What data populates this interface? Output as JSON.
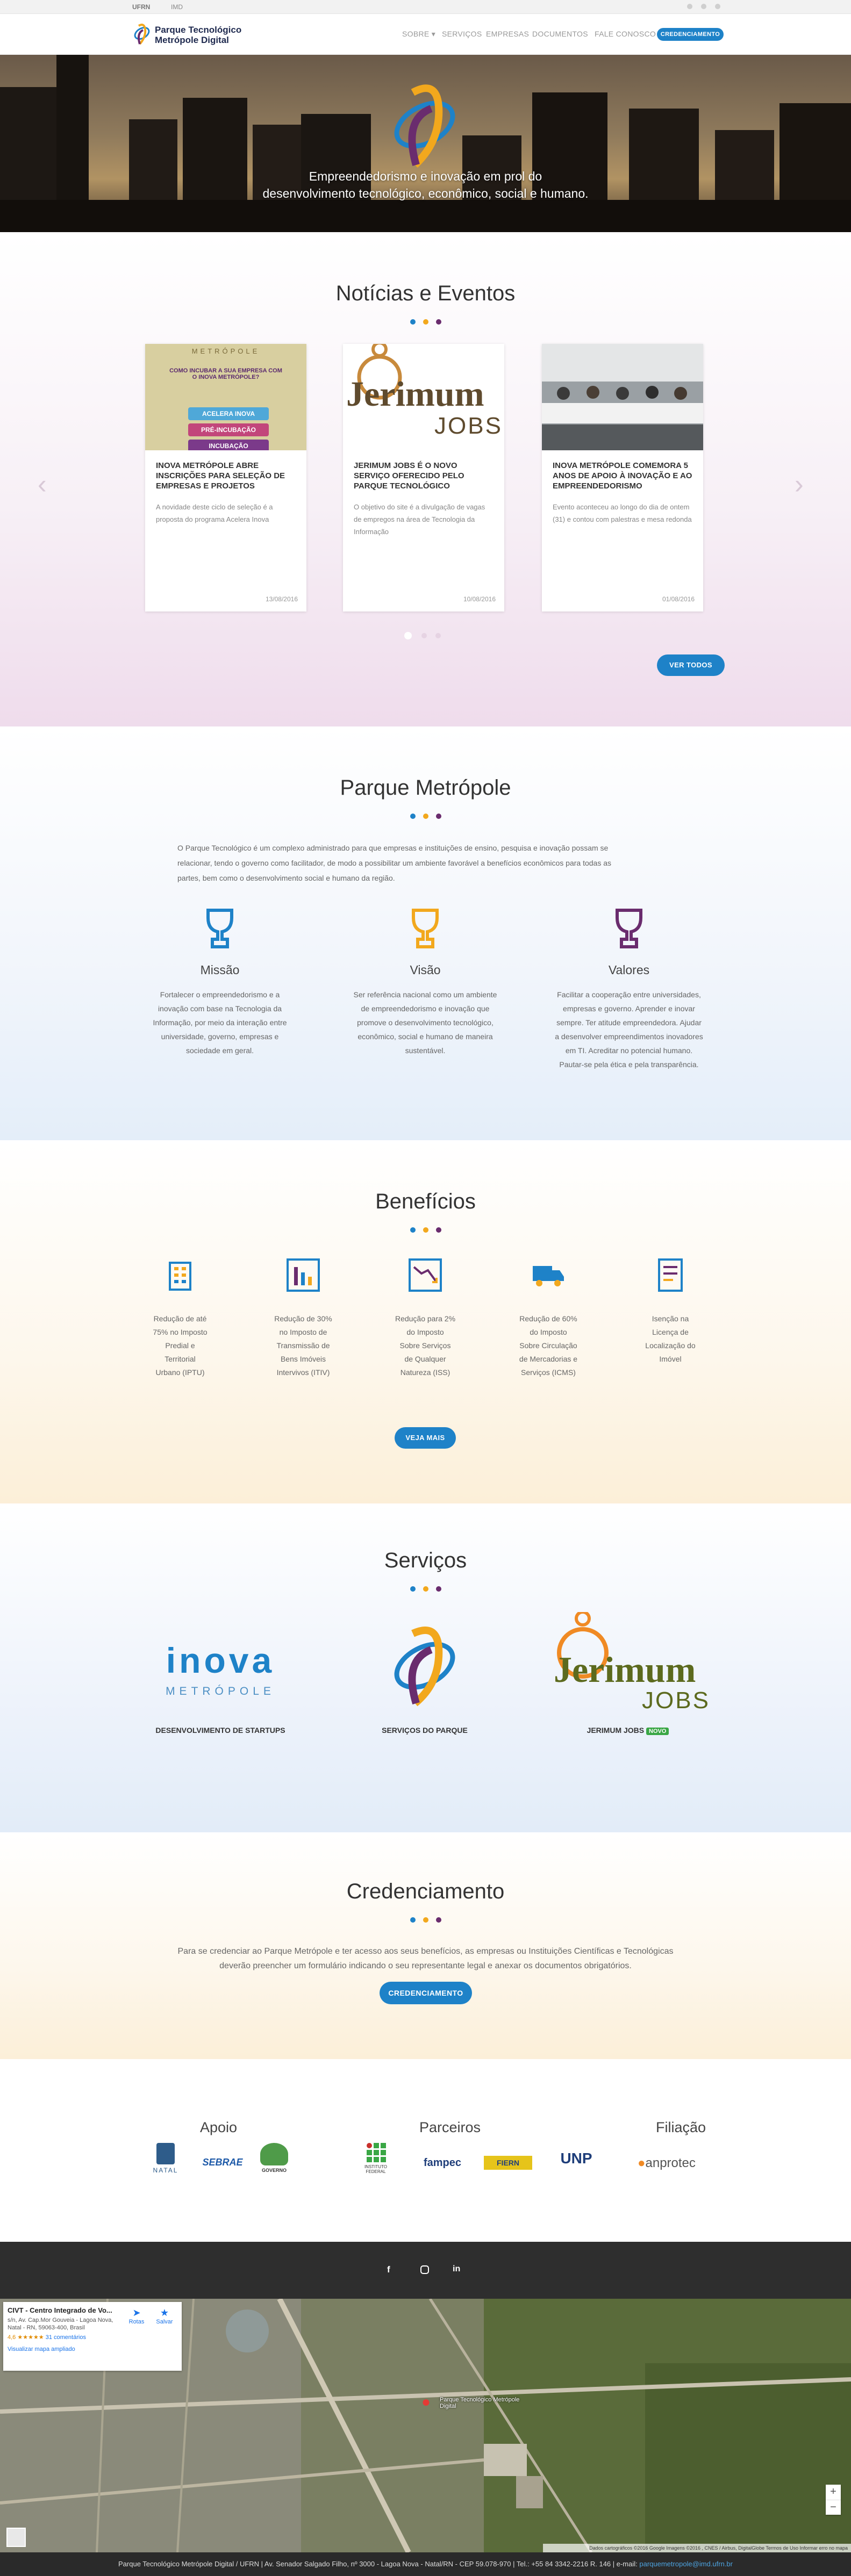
{
  "topbar": {
    "links": [
      "UFRN",
      "IMD"
    ],
    "social": [
      "facebook-icon",
      "instagram-icon",
      "linkedin-icon"
    ]
  },
  "header": {
    "logo_line1": "Parque Tecnológico",
    "logo_line2": "Metrópole Digital",
    "menu": [
      "SOBRE ▾",
      "SERVIÇOS",
      "EMPRESAS",
      "DOCUMENTOS",
      "FALE CONOSCO"
    ],
    "cta": "CREDENCIAMENTO"
  },
  "hero": {
    "title_line1": "Empreendedorismo e inovação em prol do",
    "title_line2": "desenvolvimento tecnológico, econômico, social e humano."
  },
  "news": {
    "title": "Notícias e Eventos",
    "cards": [
      {
        "title": "INOVA METRÓPOLE ABRE INSCRIÇÕES PARA SELEÇÃO DE EMPRESAS E PROJETOS",
        "text": "A novidade deste ciclo de seleção é a proposta do programa Acelera Inova",
        "date": "13/08/2016",
        "img_brand": "METRÓPOLE",
        "img_headline": "COMO INCUBAR A SUA EMPRESA COM O INOVA METRÓPOLE?",
        "img_tags": [
          "ACELERA INOVA",
          "PRÉ-INCUBAÇÃO",
          "INCUBAÇÃO"
        ]
      },
      {
        "title": "JERIMUM JOBS É O NOVO SERVIÇO OFERECIDO PELO PARQUE TECNOLÓGICO",
        "text": "O objetivo do site é a divulgação de vagas de empregos na área de Tecnologia da Informação",
        "date": "10/08/2016",
        "img_brand": "Jerimum",
        "img_sub": "JOBS"
      },
      {
        "title": "INOVA METRÓPOLE COMEMORA 5 ANOS DE APOIO À INOVAÇÃO E AO EMPREENDEDORISMO",
        "text": "Evento aconteceu ao longo do dia de ontem (31) e contou com palestras e mesa redonda",
        "date": "01/08/2016"
      }
    ],
    "view_all": "VER TODOS"
  },
  "about": {
    "title": "Parque Metrópole",
    "intro_lines": [
      "O Parque Tecnológico é um complexo administrado para que empresas e instituições de ensino, pesquisa e inovação possam se",
      "relacionar, tendo o governo como facilitador, de modo a possibilitar um ambiente favorável a benefícios econômicos para todas as",
      "partes, bem como o desenvolvimento social e humano da região."
    ],
    "columns": [
      {
        "title": "Missão",
        "color": "#1e82c8",
        "lines": [
          "Fortalecer o empreendedorismo e a",
          "inovação com base na Tecnologia da",
          "Informação, por meio da interação entre",
          "universidade, governo, empresas e",
          "sociedade em geral."
        ]
      },
      {
        "title": "Visão",
        "color": "#f2a81d",
        "lines": [
          "Ser referência nacional como um ambiente",
          "de empreendedorismo e inovação que",
          "promove o desenvolvimento tecnológico,",
          "econômico, social e humano de maneira",
          "sustentável."
        ]
      },
      {
        "title": "Valores",
        "color": "#6a2c6e",
        "lines": [
          "Facilitar a cooperação entre universidades,",
          "empresas e governo. Aprender e inovar",
          "sempre. Ter atitude empreendedora. Ajudar",
          "a desenvolver empreendimentos inovadores",
          "em TI. Acreditar no potencial humano.",
          "Pautar-se pela ética e pela transparência."
        ]
      }
    ]
  },
  "benefits": {
    "title": "Benefícios",
    "items": [
      {
        "icon": "building-icon",
        "lines": [
          "Redução de até",
          "75% no Imposto",
          "Predial e",
          "Territorial",
          "Urbano (IPTU)"
        ]
      },
      {
        "icon": "bar-chart-icon",
        "lines": [
          "Redução de 30%",
          "no Imposto de",
          "Transmissão de",
          "Bens Imóveis",
          "Intervivos (ITIV)"
        ]
      },
      {
        "icon": "line-chart-icon",
        "lines": [
          "Redução para 2%",
          "do Imposto",
          "Sobre Serviços",
          "de Qualquer",
          "Natureza (ISS)"
        ]
      },
      {
        "icon": "truck-icon",
        "lines": [
          "Redução de 60%",
          "do Imposto",
          "Sobre Circulação",
          "de Mercadorias e",
          "Serviços (ICMS)"
        ]
      },
      {
        "icon": "document-icon",
        "lines": [
          "Isenção na",
          "Licença de",
          "Localização do",
          "Imóvel"
        ]
      }
    ],
    "more": "VEJA MAIS"
  },
  "services": {
    "title": "Serviços",
    "items": [
      {
        "label": "DESENVOLVIMENTO DE STARTUPS",
        "brand": "inova",
        "sub": "METRÓPOLE"
      },
      {
        "label": "SERVIÇOS DO PARQUE"
      },
      {
        "label": "JERIMUM JOBS",
        "badge": "NOVO",
        "brand": "Jerimum",
        "sub": "JOBS"
      }
    ]
  },
  "accreditation": {
    "title": "Credenciamento",
    "lines": [
      "Para se credenciar ao Parque Metrópole e ter acesso aos seus benefícios, as empresas ou Instituições Científicas e Tecnológicas",
      "deverão preencher um formulário indicando o seu representante legal e anexar os documentos obrigatórios."
    ],
    "button": "CREDENCIAMENTO"
  },
  "partners": {
    "apoio_title": "Apoio",
    "apoio": [
      "NATAL",
      "SEBRAE",
      "GOVERNO"
    ],
    "parceiros_title": "Parceiros",
    "parceiros": [
      "INSTITUTO FEDERAL",
      "fampec",
      "FIERN",
      "UNP"
    ],
    "filiacao_title": "Filiação",
    "filiacao": [
      "anprotec"
    ]
  },
  "map": {
    "place": "CIVT - Centro Integrado de Vo...",
    "address": "s/n, Av. Cap.Mor Gouveia - Lagoa Nova, Natal - RN, 59063-400, Brasil",
    "rating": "4,6",
    "stars": "★★★★★",
    "reviews": "31 comentários",
    "enlarge": "Visualizar mapa ampliado",
    "route": "Rotas",
    "save": "Salvar",
    "zoom_in": "+",
    "zoom_out": "−",
    "marker_label": "Parque Tecnológico Metrópole Digital",
    "credits": "Dados cartográficos ©2016 Google Imagens ©2016 , CNES / Airbus, DigitalGlobe   Termos de Uso   Informar erro no mapa"
  },
  "footer": {
    "text": "Parque Tecnológico Metrópole Digital / UFRN | Av. Senador Salgado Filho, nº 3000 - Lagoa Nova - Natal/RN - CEP 59.078-970 | Tel.: +55 84 3342-2216 R. 146 | e-mail: ",
    "email": "parquemetropole@imd.ufrn.br"
  },
  "colors": {
    "blue": "#1e82c8",
    "yellow": "#f2a81d",
    "purple": "#6a2c6e",
    "green": "#3aa745"
  }
}
